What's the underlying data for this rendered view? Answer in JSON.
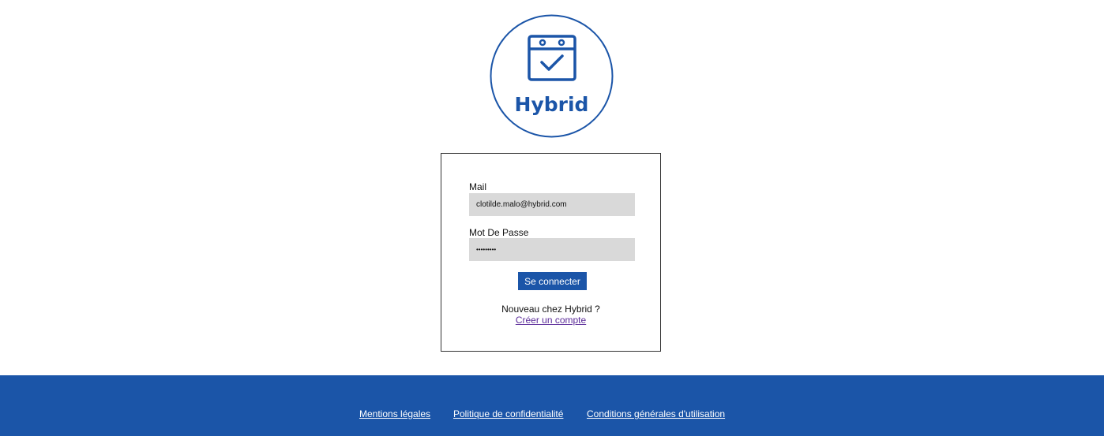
{
  "brand": {
    "name": "Hybrid",
    "color": "#1b55a8"
  },
  "login": {
    "mail_label": "Mail",
    "mail_value": "clotilde.malo@hybrid.com",
    "password_label": "Mot De Passe",
    "password_value": "•••••••••",
    "submit_label": "Se connecter",
    "new_user_text": "Nouveau chez Hybrid ?",
    "create_account_link": "Créer un compte"
  },
  "footer": {
    "links": [
      "Mentions légales",
      "Politique de confidentialité",
      "Conditions générales d'utilisation"
    ],
    "background": "#1b55a8"
  }
}
